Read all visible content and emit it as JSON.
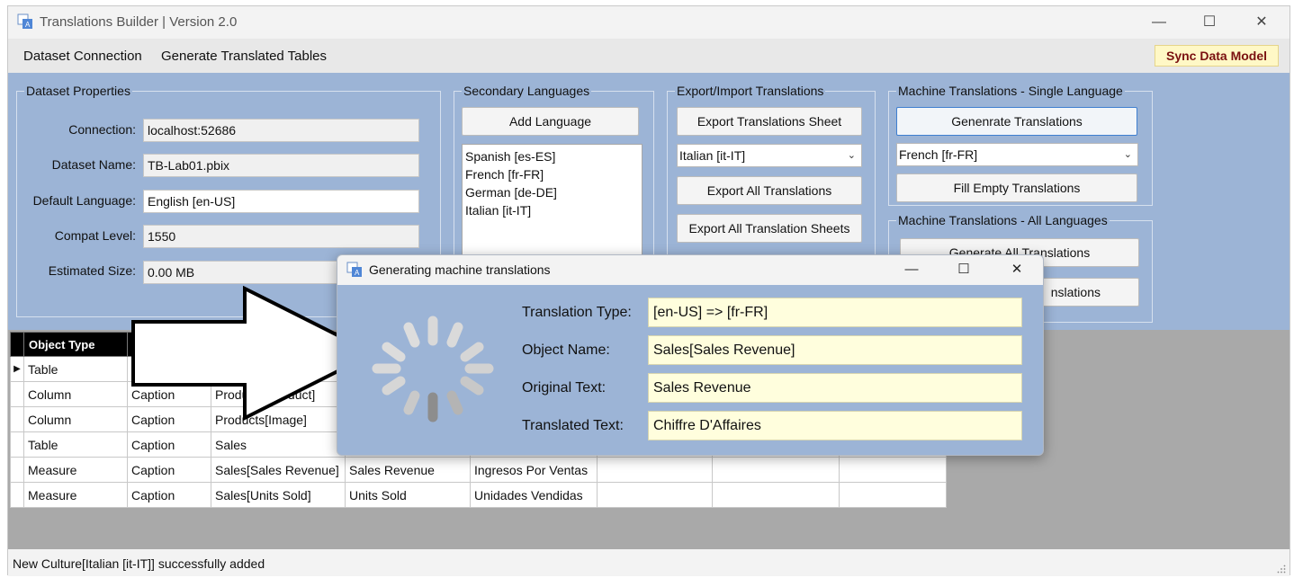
{
  "window": {
    "title": "Translations Builder | Version 2.0",
    "controls": {
      "minimize": "—",
      "maximize": "☐",
      "close": "✕"
    }
  },
  "menu": {
    "dataset_connection": "Dataset Connection",
    "generate_translated_tables": "Generate Translated Tables",
    "sync_data_model": "Sync Data Model"
  },
  "dataset_properties": {
    "legend": "Dataset Properties",
    "connection_label": "Connection:",
    "connection_value": "localhost:52686",
    "dataset_name_label": "Dataset Name:",
    "dataset_name_value": "TB-Lab01.pbix",
    "default_language_label": "Default Language:",
    "default_language_value": "English [en-US]",
    "compat_level_label": "Compat Level:",
    "compat_level_value": "1550",
    "estimated_size_label": "Estimated Size:",
    "estimated_size_value": "0.00 MB"
  },
  "secondary_languages": {
    "legend": "Secondary Languages",
    "add_button": "Add Language",
    "items": [
      "Spanish [es-ES]",
      "French [fr-FR]",
      "German [de-DE]",
      "Italian [it-IT]"
    ]
  },
  "export_import": {
    "legend": "Export/Import Translations",
    "export_sheet_button": "Export Translations Sheet",
    "language_select": "Italian [it-IT]",
    "export_all_button": "Export All Translations",
    "export_all_sheets_button": "Export All Translation Sheets"
  },
  "machine_single": {
    "legend": "Machine Translations - Single Language",
    "generate_button": "Genenrate Translations",
    "language_select": "French [fr-FR]",
    "fill_empty_button": "Fill Empty Translations"
  },
  "machine_all": {
    "legend": "Machine Translations - All Languages",
    "generate_all_button": "Generate All Translations",
    "fill_all_button": "nslations"
  },
  "grid": {
    "header_object_type": "Object Type",
    "rows": [
      {
        "marker": "▶",
        "object_type": "Table",
        "property": "",
        "name": "",
        "value": "",
        "translation": ""
      },
      {
        "marker": "",
        "object_type": "Column",
        "property": "Caption",
        "name": "Products[Product]",
        "value": "",
        "translation": ""
      },
      {
        "marker": "",
        "object_type": "Column",
        "property": "Caption",
        "name": "Products[Image]",
        "value": "",
        "translation": ""
      },
      {
        "marker": "",
        "object_type": "Table",
        "property": "Caption",
        "name": "Sales",
        "value": "",
        "translation": ""
      },
      {
        "marker": "",
        "object_type": "Measure",
        "property": "Caption",
        "name": "Sales[Sales Revenue]",
        "value": "Sales Revenue",
        "translation": "Ingresos Por Ventas"
      },
      {
        "marker": "",
        "object_type": "Measure",
        "property": "Caption",
        "name": "Sales[Units Sold]",
        "value": "Units Sold",
        "translation": "Unidades Vendidas"
      }
    ]
  },
  "status": {
    "text": "New Culture[Italian [it-IT]] successfully added"
  },
  "dialog": {
    "title": "Generating machine translations",
    "translation_type_label": "Translation Type:",
    "translation_type_value": "[en-US] => [fr-FR]",
    "object_name_label": "Object Name:",
    "object_name_value": "Sales[Sales Revenue]",
    "original_text_label": "Original Text:",
    "original_text_value": "Sales Revenue",
    "translated_text_label": "Translated Text:",
    "translated_text_value": "Chiffre D'Affaires"
  },
  "colors": {
    "panel_blue": "#9cb4d6",
    "sync_bg": "#fff8c6",
    "sync_text": "#7a1010",
    "dialog_field_bg": "#fffedd"
  }
}
